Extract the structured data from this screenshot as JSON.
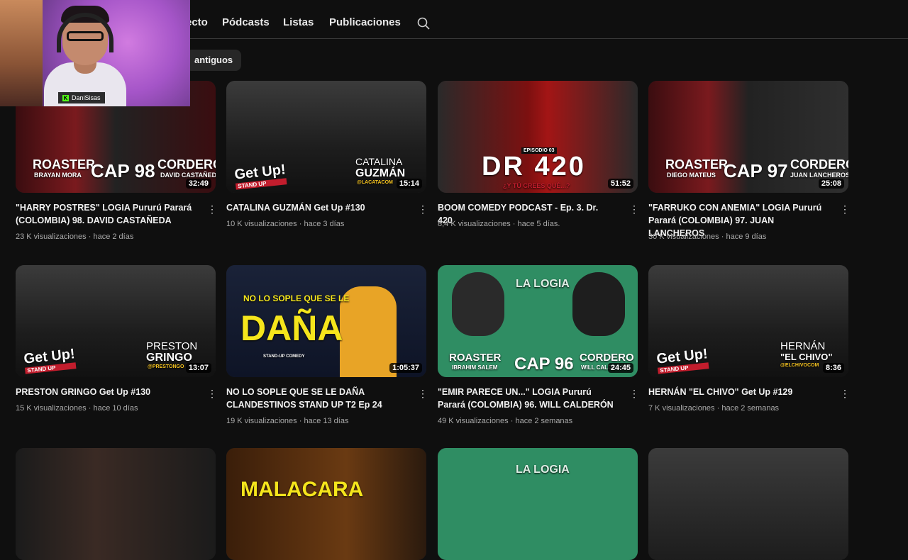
{
  "tabs": [
    "ecto",
    "Pódcasts",
    "Listas",
    "Publicaciones"
  ],
  "search_icon": "search-icon",
  "filter_chip": "antiguos",
  "webcam": {
    "name": "DaniSisas"
  },
  "videos": [
    {
      "title": "\"HARRY POSTRES\" LOGIA Pururú Parará (COLOMBIA) 98. DAVID CASTAÑEDA",
      "views": "23 K visualizaciones",
      "age": "hace 2 días",
      "duration": "32:49",
      "thumb": {
        "left": "ROASTER",
        "left_sub": "BRAYAN MORA",
        "center": "CAP 98",
        "right": "CORDERO",
        "right_sub": "DAVID CASTAÑEDA"
      }
    },
    {
      "title": "CATALINA GUZMÁN Get Up #130",
      "views": "10 K visualizaciones",
      "age": "hace 3 días",
      "duration": "15:14",
      "thumb": {
        "name1": "CATALINA",
        "name2": "GUZMÁN",
        "handle": "@LACATACOM",
        "brand": "Get Up!",
        "brand_sub": "STAND UP"
      }
    },
    {
      "title": "BOOM COMEDY PODCAST - Ep. 3. Dr. 420",
      "views": "8,4 K visualizaciones",
      "age": "hace 5 días.",
      "duration": "51:52",
      "thumb": {
        "episode": "EPISODIO 03",
        "big": "DR 420",
        "tagline": "¿Y TÚ CREES QUÉ...?"
      }
    },
    {
      "title": "\"FARRUKO CON ANEMIA\" LOGIA Pururú Parará (COLOMBIA) 97. JUAN LANCHEROS",
      "views": "30 K visualizaciones",
      "age": "hace 9 días",
      "duration": "25:08",
      "thumb": {
        "left": "ROASTER",
        "left_sub": "DIEGO MATEUS",
        "center": "CAP 97",
        "right": "CORDERO",
        "right_sub": "JUAN LANCHEROS"
      }
    },
    {
      "title": "PRESTON GRINGO Get Up #130",
      "views": "15 K visualizaciones",
      "age": "hace 10 días",
      "duration": "13:07",
      "thumb": {
        "name1": "PRESTON",
        "name2": "GRINGO",
        "handle": "@PRESTONGO",
        "brand": "Get Up!",
        "brand_sub": "STAND UP"
      }
    },
    {
      "title": "NO LO SOPLE QUE SE LE DAÑA CLANDESTINOS STAND UP T2 Ep 24",
      "views": "19 K visualizaciones",
      "age": "hace 13 días",
      "duration": "1:05:37",
      "thumb": {
        "line1": "NO LO SOPLE QUE SE LE",
        "big": "DAÑA",
        "sub": "STAND-UP COMEDY"
      }
    },
    {
      "title": "\"EMIR PARECE UN...\" LOGIA Pururú Parará (COLOMBIA) 96. WILL CALDERÓN",
      "views": "49 K visualizaciones",
      "age": "hace 2 semanas",
      "duration": "24:45",
      "thumb": {
        "left": "ROASTER",
        "left_sub": "IBRAHIM SALEM",
        "center": "CAP 96",
        "right": "CORDERO",
        "right_sub": "WILL CALDERÓN",
        "logo": "LA LOGIA"
      }
    },
    {
      "title": "HERNÁN \"EL CHIVO\" Get Up #129",
      "views": "7 K visualizaciones",
      "age": "hace 2 semanas",
      "duration": "8:36",
      "thumb": {
        "name1": "HERNÁN",
        "name2": "\"EL CHIVO\"",
        "handle": "@ELCHIVOCOM",
        "brand": "Get Up!",
        "brand_sub": "STAND UP"
      }
    }
  ],
  "row3": [
    {
      "text": ""
    },
    {
      "text": "MALACARA"
    },
    {
      "text": "LA LOGIA"
    },
    {
      "text": ""
    }
  ]
}
